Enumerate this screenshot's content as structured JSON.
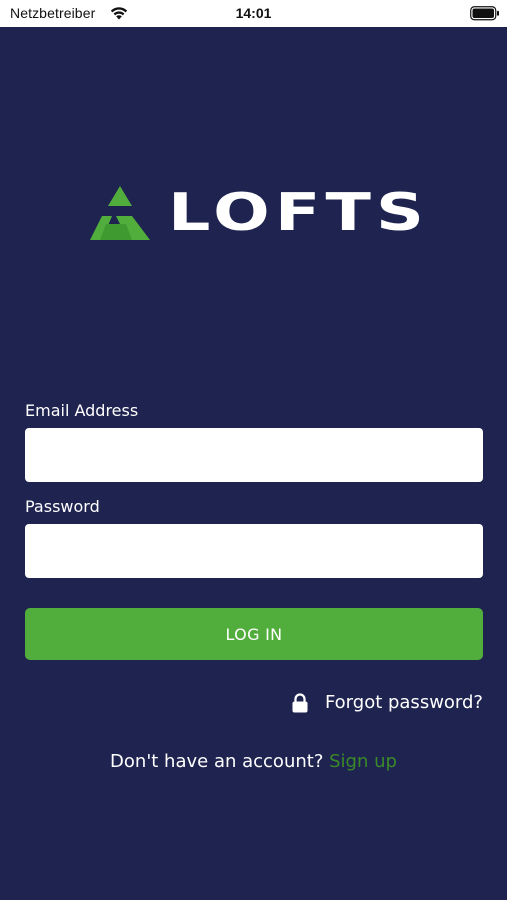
{
  "status_bar": {
    "carrier": "Netzbetreiber",
    "time": "14:01",
    "wifi_icon": "wifi-icon",
    "battery_icon": "battery-icon"
  },
  "brand": {
    "logo_text": "LOFTS",
    "logo_icon": "lofts-triangle-logo",
    "colors": {
      "background": "#1f2350",
      "accent_green": "#52ae3c",
      "link_green": "#3a8a28"
    }
  },
  "form": {
    "email_label": "Email Address",
    "email_value": "",
    "password_label": "Password",
    "password_value": "",
    "login_label": "LOG IN",
    "forgot_label": "Forgot password?",
    "forgot_icon": "lock-icon"
  },
  "signup": {
    "prompt": "Don't have an account?",
    "link_label": "Sign up"
  }
}
